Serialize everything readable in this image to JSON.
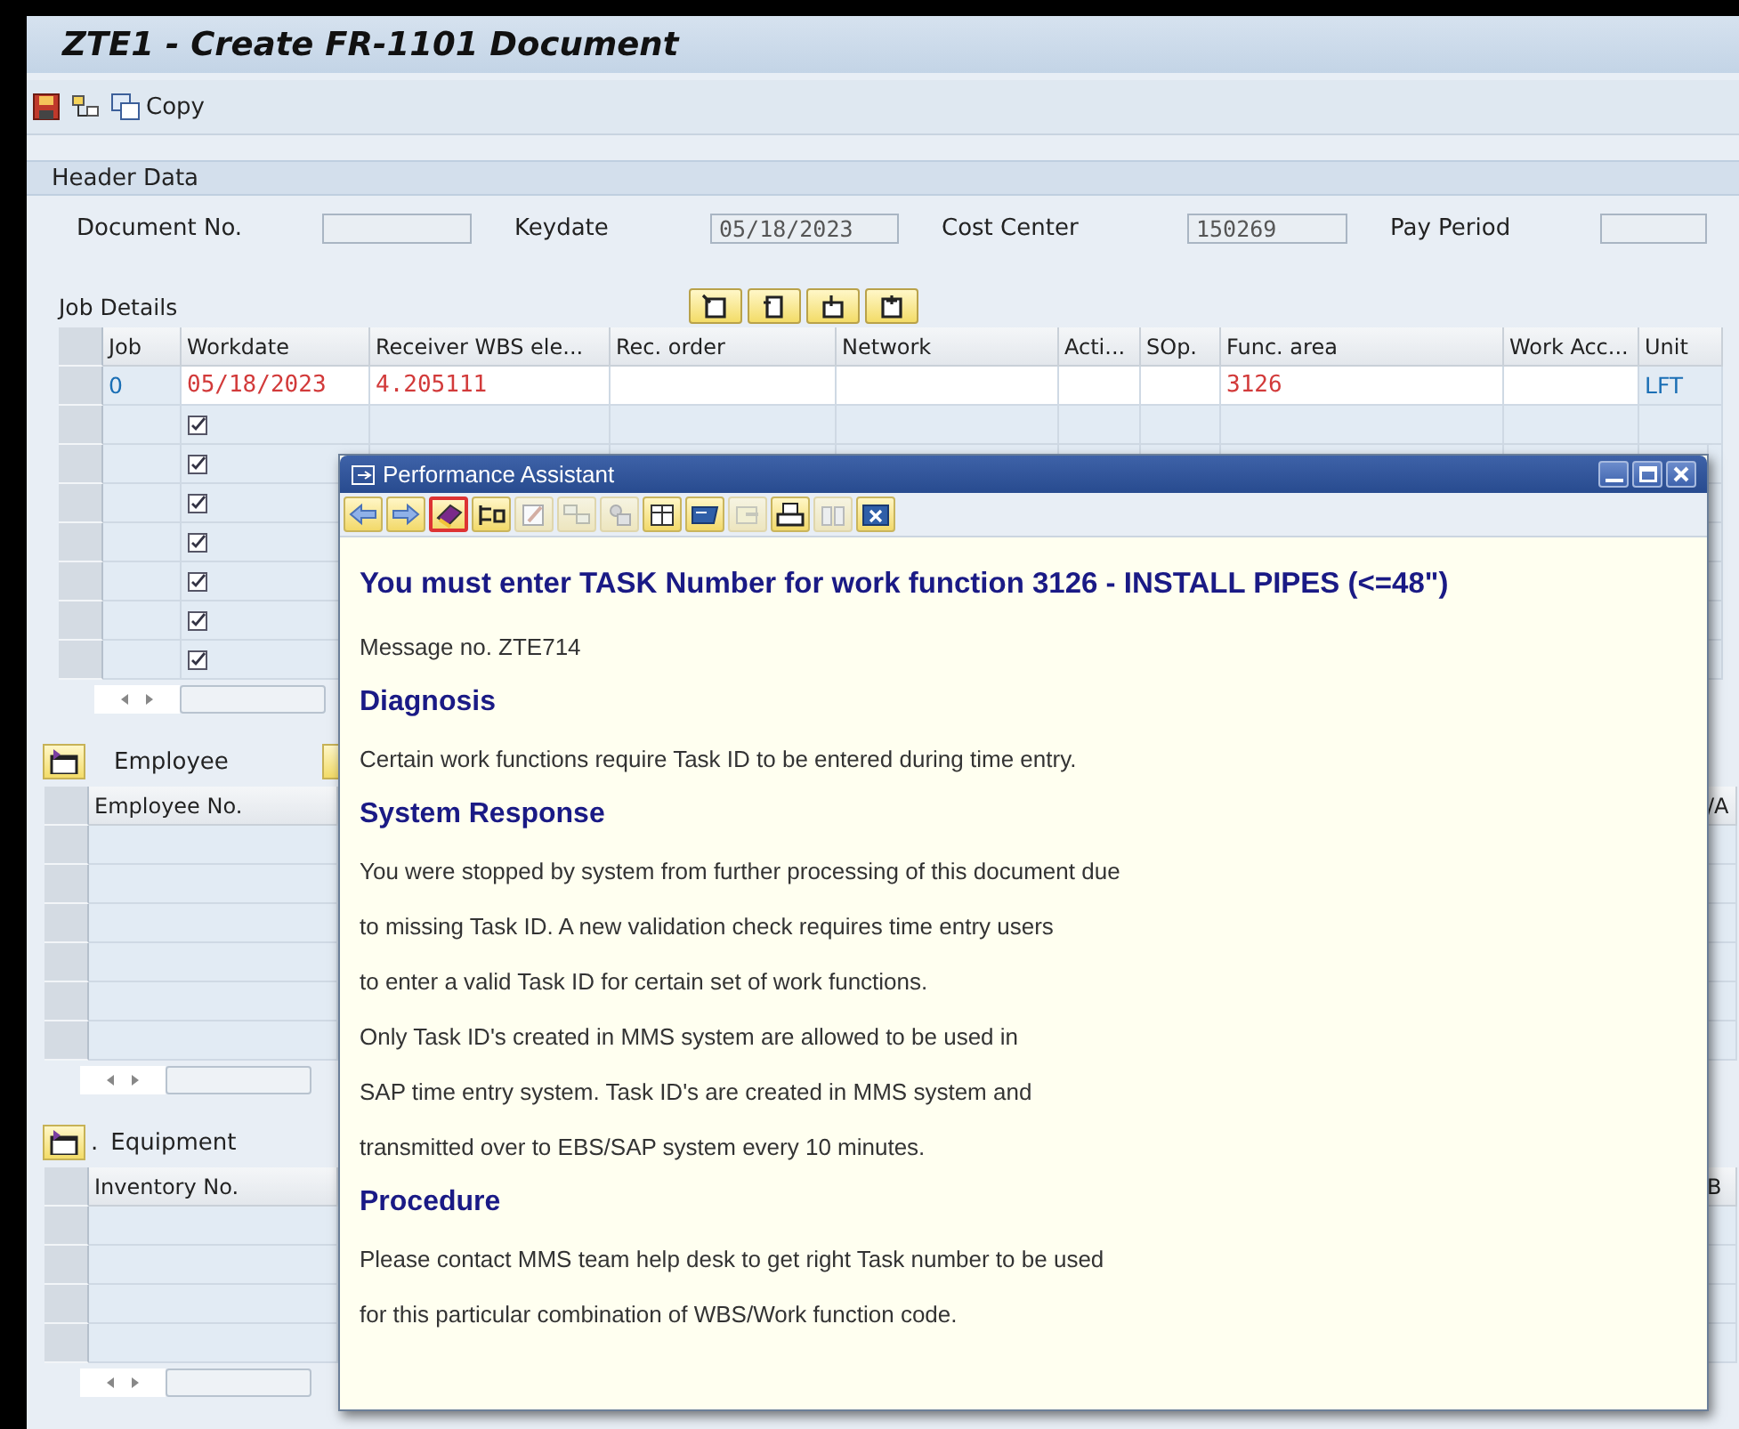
{
  "window": {
    "title": "ZTE1 - Create FR-1101 Document"
  },
  "toolbar": {
    "copy_label": "Copy"
  },
  "header_data": {
    "title": "Header Data",
    "fields": [
      {
        "label": "Document No."
      },
      {
        "label": "Keydate",
        "value": "05/18/2023"
      },
      {
        "label": "Cost Center",
        "value": "150269"
      },
      {
        "label": "Pay Period"
      }
    ]
  },
  "job_details": {
    "title": "Job Details",
    "columns": [
      "Job",
      "Workdate",
      "Receiver WBS ele...",
      "Rec. order",
      "Network",
      "Acti...",
      "SOp.",
      "Func. area",
      "Work Acc...",
      "Unit"
    ],
    "rows": [
      {
        "kind": "entry",
        "cells": [
          {
            "text": "0",
            "error": false
          },
          {
            "text": "05/18/2023",
            "error": true
          },
          {
            "text": "4.205111",
            "error": true
          },
          null,
          null,
          null,
          null,
          {
            "text": "3126",
            "error": true
          },
          null,
          {
            "text": "LFT",
            "error": false
          }
        ]
      },
      {
        "kind": "new",
        "checked": true
      },
      {
        "kind": "new",
        "checked": true
      },
      {
        "kind": "new",
        "checked": true
      },
      {
        "kind": "new",
        "checked": true
      },
      {
        "kind": "new",
        "checked": true
      },
      {
        "kind": "new",
        "checked": true
      },
      {
        "kind": "new",
        "checked": true
      }
    ]
  },
  "employee": {
    "tab": "Employee",
    "columns": [
      "Employee No.",
      "/A"
    ]
  },
  "equipment": {
    "tab_prefix": ".",
    "tab": "Equipment",
    "columns": [
      "Inventory No.",
      "B"
    ]
  },
  "popup": {
    "title": "Performance Assistant",
    "toolbar": [
      {
        "kind": "back",
        "selected": false,
        "disabled": false
      },
      {
        "kind": "forward",
        "selected": false,
        "disabled": false
      },
      {
        "kind": "book",
        "selected": true,
        "disabled": false
      },
      {
        "kind": "tools",
        "selected": false,
        "disabled": false
      },
      {
        "kind": "edit",
        "selected": false,
        "disabled": true
      },
      {
        "kind": "split",
        "selected": false,
        "disabled": true
      },
      {
        "kind": "people",
        "selected": false,
        "disabled": true
      },
      {
        "kind": "table",
        "selected": false,
        "disabled": false
      },
      {
        "kind": "display",
        "selected": false,
        "disabled": false
      },
      {
        "kind": "export",
        "selected": false,
        "disabled": true
      },
      {
        "kind": "print",
        "selected": false,
        "disabled": false
      },
      {
        "kind": "find",
        "selected": false,
        "disabled": true
      },
      {
        "kind": "close",
        "selected": false,
        "disabled": false
      }
    ],
    "content": [
      {
        "kind": "title",
        "text": "You must enter TASK Number for work function 3126 - INSTALL PIPES (<=48\")"
      },
      {
        "kind": "text",
        "text": "Message no. ZTE714"
      },
      {
        "kind": "heading",
        "text": "Diagnosis"
      },
      {
        "kind": "text",
        "text": "Certain work functions require Task ID to be entered during time entry."
      },
      {
        "kind": "heading",
        "text": "System Response"
      },
      {
        "kind": "text",
        "text": "You were stopped by system from further processing of this document due"
      },
      {
        "kind": "text",
        "text": "to missing Task ID. A new validation check requires time entry users"
      },
      {
        "kind": "text",
        "text": "to enter a valid Task ID for certain set of work functions."
      },
      {
        "kind": "text",
        "text": "Only Task ID's created in MMS system are allowed to be used in"
      },
      {
        "kind": "text",
        "text": "SAP time entry system. Task ID's are created in MMS system and"
      },
      {
        "kind": "text",
        "text": "transmitted over to EBS/SAP system every 10 minutes."
      },
      {
        "kind": "heading",
        "text": "Procedure"
      },
      {
        "kind": "text",
        "text": "Please contact MMS team help desk to get right Task number to be used"
      },
      {
        "kind": "text",
        "text": "for this particular combination of WBS/Work function code."
      }
    ]
  }
}
